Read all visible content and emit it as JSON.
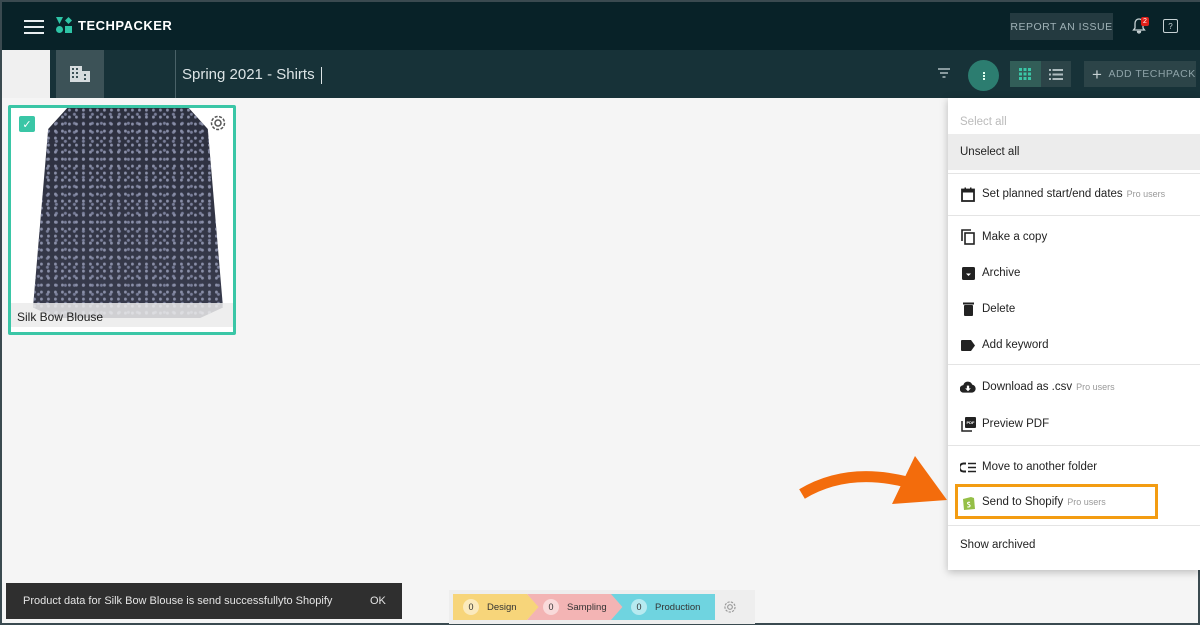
{
  "app": {
    "name": "TECHPACKER"
  },
  "topbar": {
    "report_label": "REPORT AN ISSUE",
    "notification_count": "2",
    "help_glyph": "?"
  },
  "subbar": {
    "folder_title": "Spring 2021 - Shirts",
    "add_label": "ADD TECHPACK",
    "view_mode": "grid"
  },
  "products": [
    {
      "name": "Silk Bow Blouse",
      "selected": true
    }
  ],
  "menu": {
    "select_all": "Select all",
    "unselect_all": "Unselect all",
    "items": [
      {
        "label": "Set planned start/end dates",
        "pro": "Pro users",
        "icon": "calendar-icon"
      },
      {
        "label": "Make a copy",
        "pro": "",
        "icon": "copy-icon"
      },
      {
        "label": "Archive",
        "pro": "",
        "icon": "archive-icon"
      },
      {
        "label": "Delete",
        "pro": "",
        "icon": "trash-icon"
      },
      {
        "label": "Add keyword",
        "pro": "",
        "icon": "label-icon"
      },
      {
        "label": "Download as .csv",
        "pro": "Pro users",
        "icon": "cloud-download-icon"
      },
      {
        "label": "Preview PDF",
        "pro": "",
        "icon": "pdf-icon"
      },
      {
        "label": "Move to another folder",
        "pro": "",
        "icon": "move-folder-icon"
      },
      {
        "label": "Send to Shopify",
        "pro": "Pro users",
        "icon": "shopify-icon"
      }
    ],
    "show_archived": "Show archived"
  },
  "toast": {
    "message": "Product data for Silk Bow Blouse is send successfullyto Shopify",
    "ok_label": "OK"
  },
  "stages": [
    {
      "count": "0",
      "label": "Design",
      "color": "#f7d57a"
    },
    {
      "count": "0",
      "label": "Sampling",
      "color": "#f3b4b4"
    },
    {
      "count": "0",
      "label": "Production",
      "color": "#6fd4e0"
    }
  ],
  "colors": {
    "accent": "#3ac6a6",
    "highlight": "#f39c12",
    "arrow": "#f36c0c"
  }
}
